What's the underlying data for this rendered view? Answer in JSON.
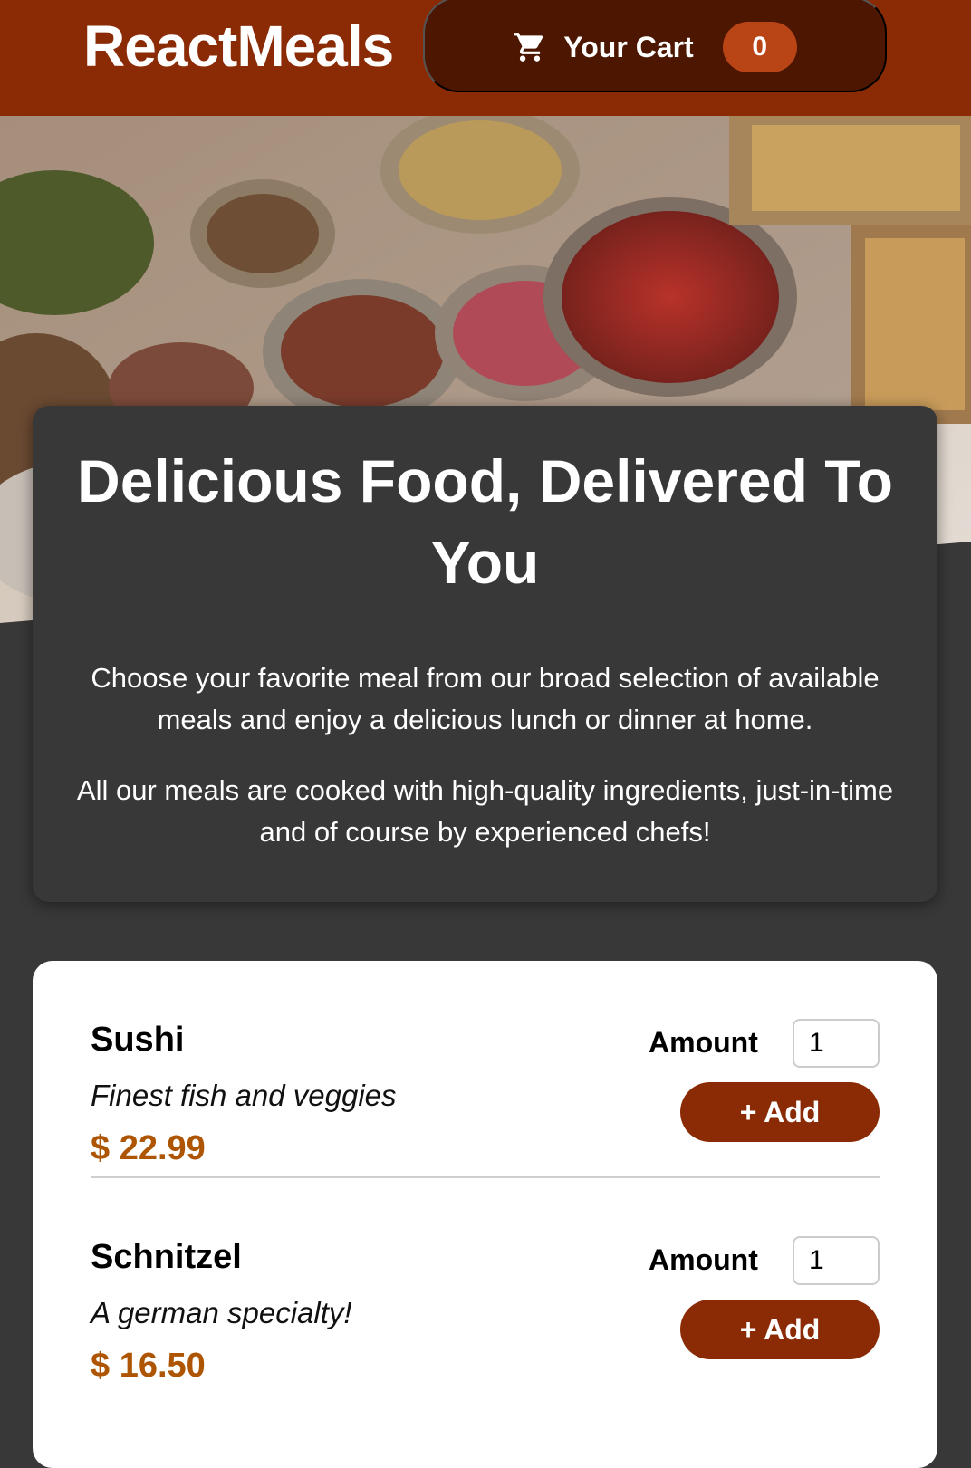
{
  "header": {
    "title": "ReactMeals",
    "cart": {
      "label": "Your Cart",
      "count": "0",
      "icon": "cart-icon"
    }
  },
  "summary": {
    "heading": "Delicious Food, Delivered To You",
    "paragraph1": "Choose your favorite meal from our broad selection of available meals and enjoy a delicious lunch or dinner at home.",
    "paragraph2": "All our meals are cooked with high-quality ingredients, just-in-time and of course by experienced chefs!"
  },
  "meals": [
    {
      "name": "Sushi",
      "description": "Finest fish and veggies",
      "price": "$ 22.99",
      "amount_label": "Amount",
      "amount_value": "1",
      "add_label": "+ Add"
    },
    {
      "name": "Schnitzel",
      "description": "A german specialty!",
      "price": "$ 16.50",
      "amount_label": "Amount",
      "amount_value": "1",
      "add_label": "+ Add"
    }
  ],
  "colors": {
    "header": "#8a2b06",
    "cart_button": "#4d1601",
    "badge": "#b94517",
    "background": "#383838",
    "price": "#ad5502"
  }
}
